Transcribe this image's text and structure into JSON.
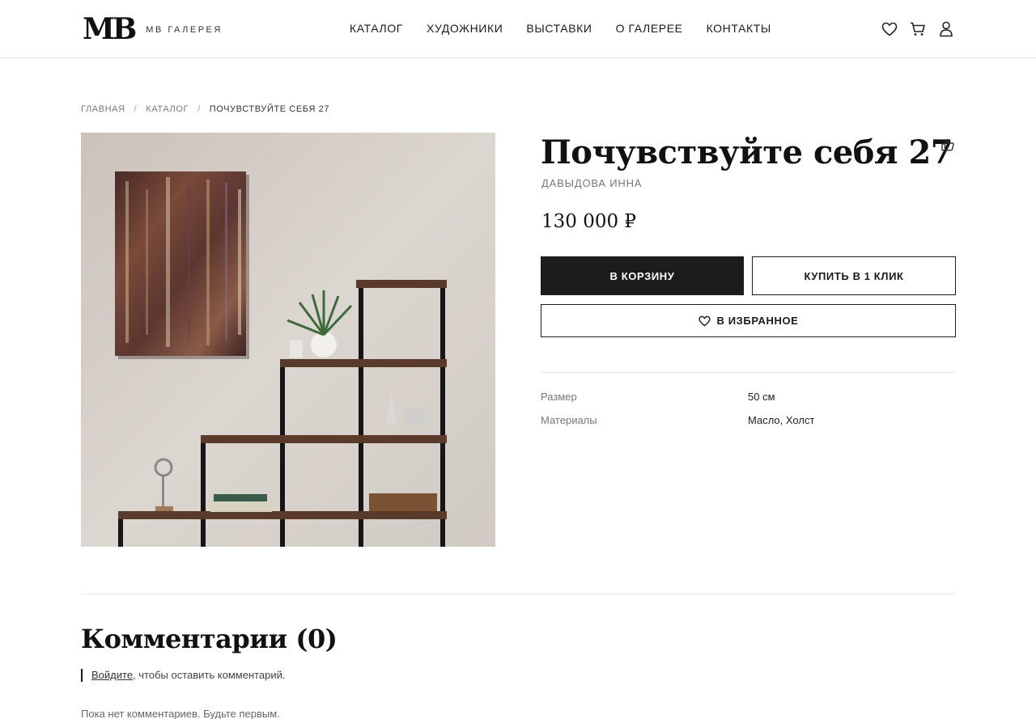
{
  "brand": {
    "logo": "MB",
    "name": "МВ ГАЛЕРЕЯ"
  },
  "nav": [
    "КАТАЛОГ",
    "ХУДОЖНИКИ",
    "ВЫСТАВКИ",
    "О ГАЛЕРЕЕ",
    "КОНТАКТЫ"
  ],
  "header_icons": [
    "heart-icon",
    "cart-icon",
    "user-icon"
  ],
  "breadcrumb": {
    "home": "ГЛАВНАЯ",
    "catalog": "КАТАЛОГ",
    "current": "ПОЧУВСТВУЙТЕ СЕБЯ 27",
    "separator": "/"
  },
  "product": {
    "title": "Почувствуйте себя 27",
    "artist": "ДАВЫДОВА ИННА",
    "price": "130 000 ₽",
    "buttons": {
      "add_to_cart": "В КОРЗИНУ",
      "one_click": "КУПИТЬ В 1 КЛИК",
      "favorite": "В ИЗБРАННОЕ"
    },
    "specs": [
      {
        "label": "Размер",
        "value": "50 см"
      },
      {
        "label": "Материалы",
        "value": "Масло, Холст"
      }
    ]
  },
  "comments": {
    "title": "Комментарии (0)",
    "login_link": "Войдите",
    "login_suffix": ", чтобы оставить комментарий.",
    "empty": "Пока нет комментариев. Будьте первым."
  },
  "colors": {
    "primary": "#1c1c1c",
    "muted": "#777777",
    "divider": "#e8e8e8"
  }
}
